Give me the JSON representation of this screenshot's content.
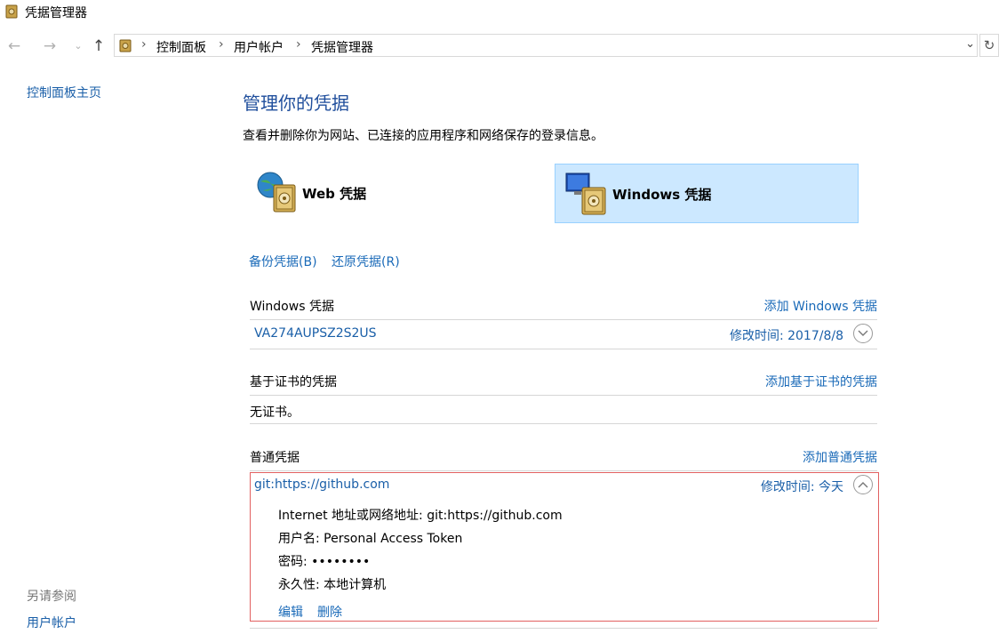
{
  "window": {
    "title": "凭据管理器"
  },
  "nav": {
    "back_icon": "arrow-left-icon",
    "forward_icon": "arrow-right-icon",
    "recent_icon": "chevron-down-icon",
    "up_icon": "arrow-up-icon"
  },
  "breadcrumb": {
    "items": [
      "控制面板",
      "用户帐户",
      "凭据管理器"
    ]
  },
  "sidebar": {
    "home_link": "控制面板主页",
    "see_also_label": "另请参阅",
    "see_also_links": [
      "用户帐户"
    ]
  },
  "main": {
    "heading": "管理你的凭据",
    "description": "查看并删除你为网站、已连接的应用程序和网络保存的登录信息。",
    "tiles": [
      {
        "label": "Web 凭据",
        "selected": false
      },
      {
        "label": "Windows 凭据",
        "selected": true
      }
    ],
    "backup_link": "备份凭据(B)",
    "restore_link": "还原凭据(R)",
    "sections": [
      {
        "title": "Windows 凭据",
        "add_link": "添加 Windows 凭据",
        "items": [
          {
            "name": "VA274AUPSZ2S2US",
            "modified": "修改时间:  2017/8/8",
            "expanded": false
          }
        ]
      },
      {
        "title": "基于证书的凭据",
        "add_link": "添加基于证书的凭据",
        "empty_text": "无证书。"
      },
      {
        "title": "普通凭据",
        "add_link": "添加普通凭据",
        "items": [
          {
            "name": "git:https://github.com",
            "modified": "修改时间:  今天",
            "expanded": true,
            "details": [
              {
                "label": "Internet 地址或网络地址:",
                "value": "git:https://github.com"
              },
              {
                "label": "用户名:",
                "value": "Personal Access Token"
              },
              {
                "label": "密码:",
                "value": "••••••••"
              },
              {
                "label": "永久性:",
                "value": "本地计算机"
              }
            ],
            "edit_link": "编辑",
            "delete_link": "删除"
          }
        ]
      }
    ]
  },
  "colors": {
    "link": "#1a6ab8",
    "heading": "#1f4e9c",
    "selected_tile_bg": "#cce8ff",
    "selected_tile_border": "#99d1ff",
    "expanded_border": "#e26060"
  }
}
